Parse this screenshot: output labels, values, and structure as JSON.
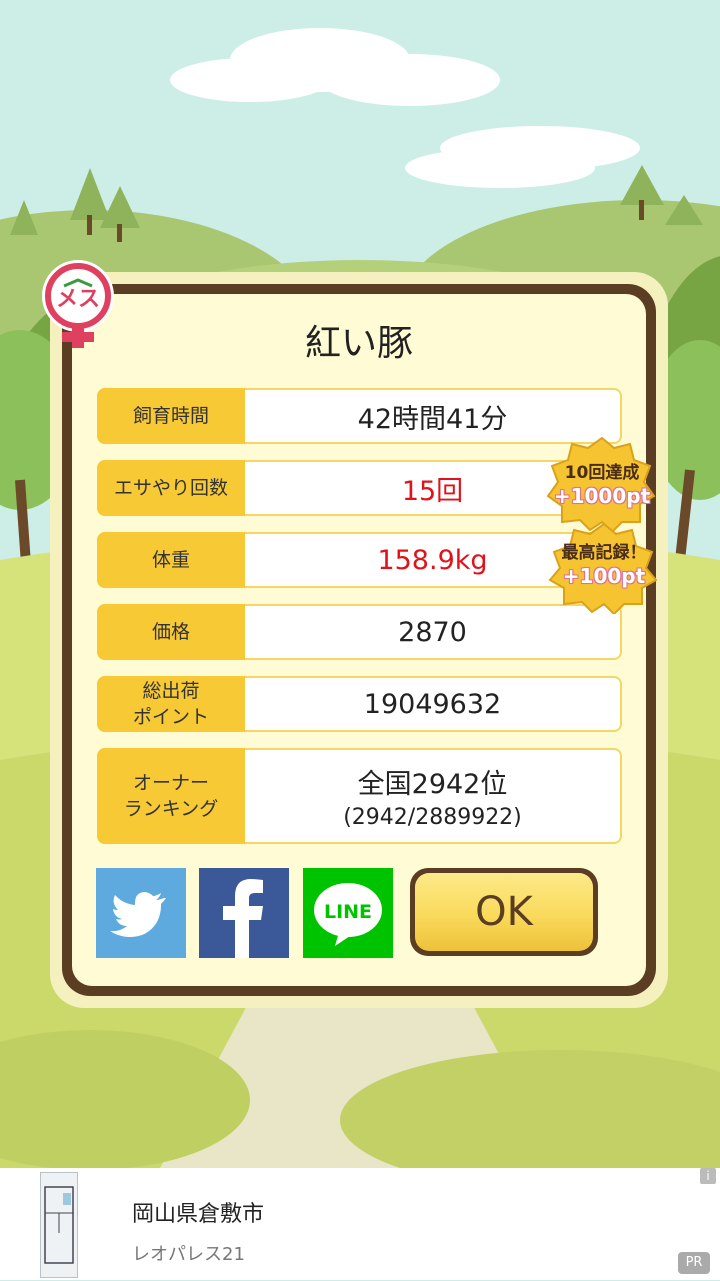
{
  "pig": {
    "name": "紅い豚",
    "gender_label": "メス"
  },
  "stats": [
    {
      "label": "飼育時間",
      "value": "42時間41分",
      "highlight": false
    },
    {
      "label": "エサやり回数",
      "value": "15回",
      "highlight": true
    },
    {
      "label": "体重",
      "value": "158.9kg",
      "highlight": true
    },
    {
      "label": "価格",
      "value": "2870",
      "highlight": false
    },
    {
      "label": "総出荷\nポイント",
      "value": "19049632",
      "highlight": false
    },
    {
      "label": "オーナー\nランキング",
      "value": "全国2942位",
      "sub": "(2942/2889922)",
      "highlight": false
    }
  ],
  "badges": [
    {
      "line1": "10回達成",
      "line2": "+1000pt"
    },
    {
      "line1": "最高記録！",
      "line2": "+100pt"
    }
  ],
  "share": {
    "twitter_icon": "twitter-bird-icon",
    "facebook_icon": "facebook-f-icon",
    "line_label": "LINE"
  },
  "ok_label": "OK",
  "ad": {
    "title": "岡山県倉敷市",
    "subtitle": "レオパレス21",
    "info_label": "i",
    "pr_label": "PR"
  },
  "colors": {
    "highlight": "#e0131b",
    "frame": "#5b3d23",
    "label_bg": "#f7c934"
  }
}
